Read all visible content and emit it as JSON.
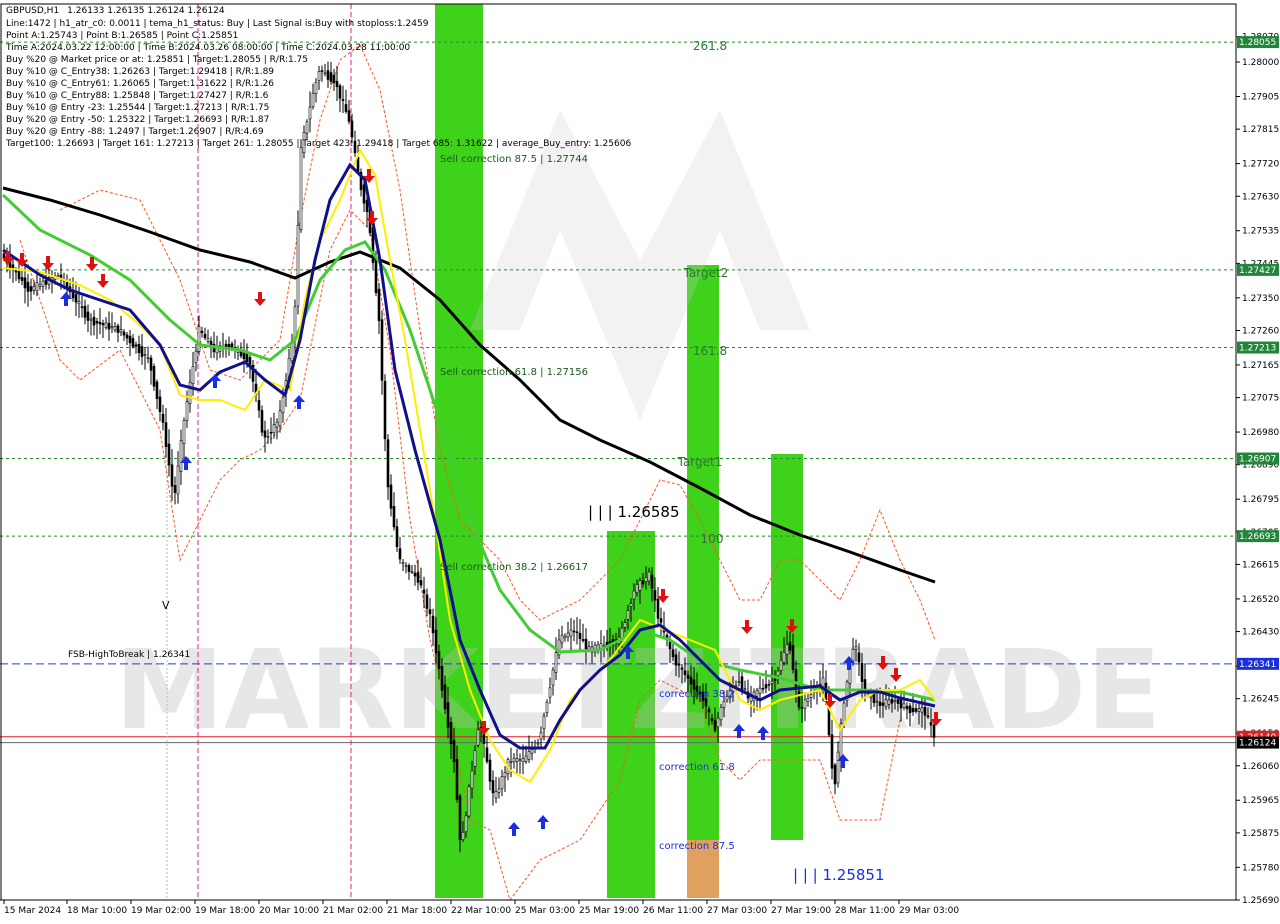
{
  "chart_data": {
    "type": "candlestick",
    "symbol": "GBPUSD,H1",
    "ohlc_header": "1.26133 1.26135 1.26124 1.26124",
    "info_lines": [
      "Line:1472 | h1_atr_c0: 0.0011 | tema_h1_status: Buy | Last Signal is:Buy with stoploss:1.2459",
      "Point A:1.25743 | Point B:1.26585 | Point C:1.25851",
      "Time A:2024.03.22 12:00:00 | Time B:2024.03.26 08:00:00 | Time C:2024.03.28 11:00:00",
      "Buy %20 @ Market price or at: 1.25851 | Target:1.28055 | R/R:1.75",
      "Buy %10 @ C_Entry38: 1.26263 | Target:1.29418 | R/R:1.89",
      "Buy %10 @ C_Entry61: 1.26065 | Target:1.31622 | R/R:1.26",
      "Buy %10 @ C_Entry88: 1.25848 | Target:1.27427 | R/R:1.6",
      "Buy %10 @ Entry -23: 1.25544 | Target:1.27213 | R/R:1.75",
      "Buy %20 @ Entry -50: 1.25322 | Target:1.26693 | R/R:1.87",
      "Buy %20 @ Entry -88: 1.2497 | Target:1.26907 | R/R:4.69",
      "Target100: 1.26693 | Target 161: 1.27213 | Target 261: 1.28055 | Target 423: 1.29418 | Target 685: 1.31622 | average_Buy_entry: 1.25606"
    ],
    "y_ticks": [
      "1.28070",
      "1.28000",
      "1.27905",
      "1.27815",
      "1.27720",
      "1.27630",
      "1.27535",
      "1.27445",
      "1.27350",
      "1.27260",
      "1.27165",
      "1.27075",
      "1.26980",
      "1.26890",
      "1.26795",
      "1.26705",
      "1.26615",
      "1.26520",
      "1.26430",
      "1.26335",
      "1.26245",
      "1.26150",
      "1.26060",
      "1.25965",
      "1.25875",
      "1.25780",
      "1.25690"
    ],
    "x_ticks": [
      "15 Mar 2024",
      "18 Mar 10:00",
      "19 Mar 02:00",
      "19 Mar 18:00",
      "20 Mar 10:00",
      "21 Mar 02:00",
      "21 Mar 18:00",
      "22 Mar 10:00",
      "25 Mar 03:00",
      "25 Mar 19:00",
      "26 Mar 11:00",
      "27 Mar 03:00",
      "27 Mar 19:00",
      "28 Mar 11:00",
      "29 Mar 03:00"
    ],
    "ylim": [
      1.2569,
      1.2816
    ],
    "grid": false,
    "price_labels": [
      {
        "value": 1.28055,
        "text": "1.28055",
        "color": "#22863a"
      },
      {
        "value": 1.27427,
        "text": "1.27427",
        "color": "#22863a"
      },
      {
        "value": 1.27213,
        "text": "1.27213",
        "color": "#22863a"
      },
      {
        "value": 1.26907,
        "text": "1.26907",
        "color": "#22863a"
      },
      {
        "value": 1.26693,
        "text": "1.26693",
        "color": "#22863a"
      },
      {
        "value": 1.26341,
        "text": "1.26341",
        "color": "#1a2ee0"
      },
      {
        "value": 1.2614,
        "text": "1.26140",
        "color": "#e02020"
      },
      {
        "value": 1.26124,
        "text": "1.26124",
        "color": "#000000"
      }
    ],
    "annotations": {
      "fib_261": "261.8",
      "target2": "Target2",
      "fib_161": "161.8",
      "target1": "Target1",
      "fib_100": "100",
      "point_b": "| | | 1.26585",
      "point_c": "| | | 1.25851",
      "sell_875": "Sell correction 87.5 | 1.27744",
      "sell_618": "Sell correction 61.8 | 1.27156",
      "sell_382": "Sell correction 38.2 | 1.26617",
      "corr_382": "correction 38.2",
      "corr_618": "correction 61.8",
      "corr_875": "correction 87.5",
      "fsb": "FSB-HighToBreak | 1.26341",
      "v_mark": "V"
    },
    "watermark": "MARKETZITRADE",
    "colors": {
      "green_bar": "#3fd21a",
      "orange_bar": "#e0a060",
      "level_green": "#2a8a2a",
      "ma_black": "#000000",
      "ma_navy": "#10108a",
      "ma_yellow": "#ffee00",
      "ma_green": "#44cc33",
      "band_red": "#ff5522",
      "buy_arrow": "#1a2ee0",
      "sell_arrow": "#e01010"
    }
  }
}
